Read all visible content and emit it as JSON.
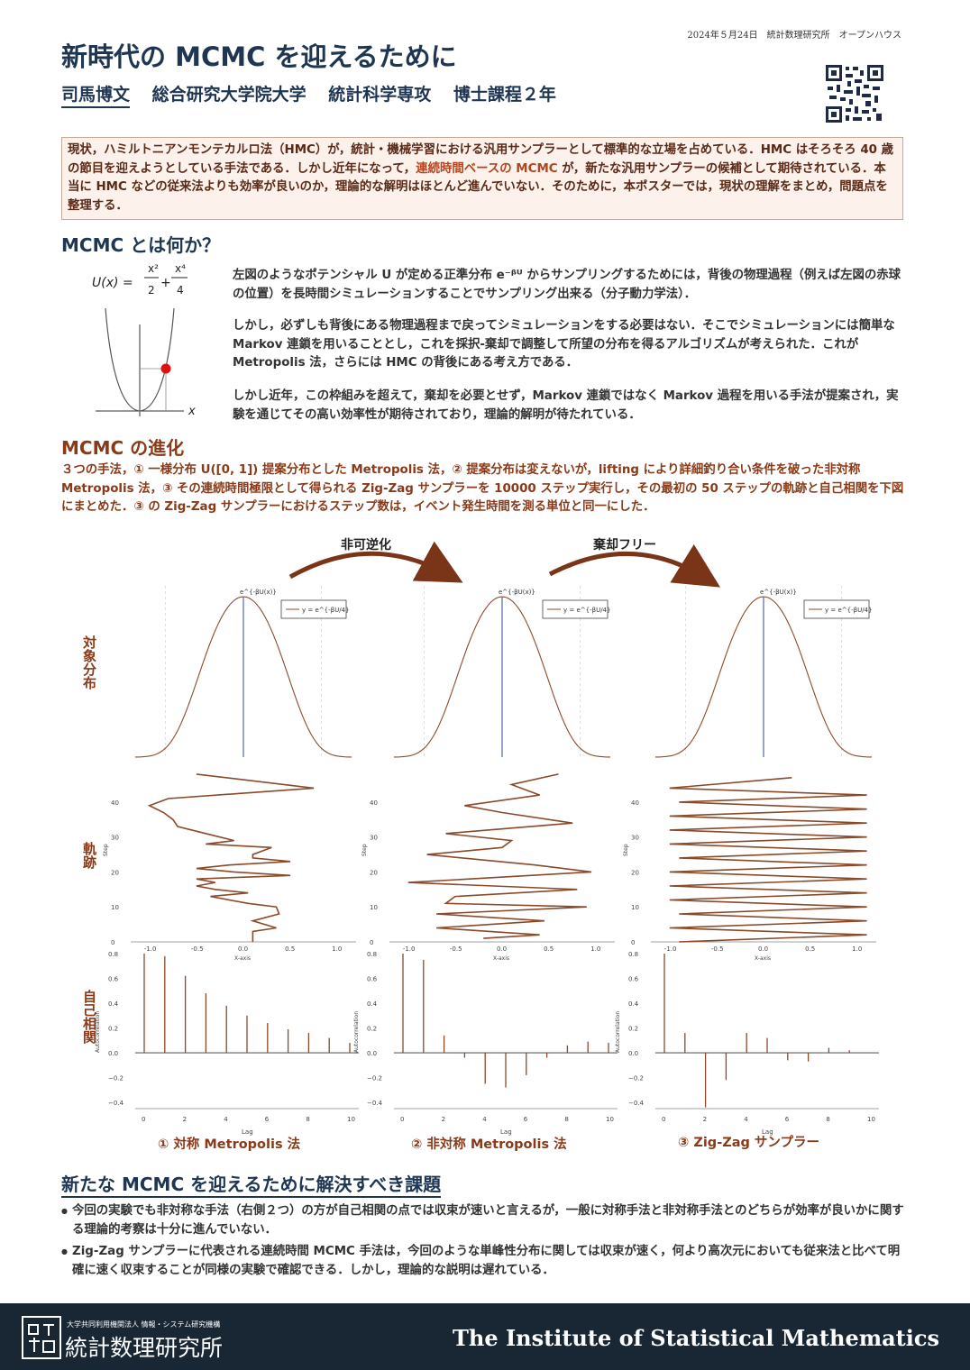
{
  "header": {
    "note": "2024年５月24日　統計数理研究所　オープンハウス",
    "title": "新時代の MCMC を迎えるために",
    "author_name": "司馬博文",
    "author_affil": [
      "総合研究大学院大学",
      "統計科学専攻",
      "博士課程２年"
    ]
  },
  "abstract": {
    "text_a": "現状，ハミルトニアンモンテカルロ法（HMC）が，統計・機械学習における汎用サンプラーとして標準的な立場を占めている．HMC はそろそろ 40 歳の節目を迎えようとしている手法である．しかし近年になって，",
    "highlight": "連続時間ベースの MCMC",
    "text_b": " が，新たな汎用サンプラーの候補として期待されている．本当に HMC などの従来法よりも効率が良いのか，理論的な解明はほとんど進んでいない．そのために，本ポスターでは，現状の理解をまとめ，問題点を整理する．"
  },
  "section1": {
    "heading": "MCMC とは何か？",
    "formula_lhs": "U(x) =",
    "formula_num1": "x²",
    "formula_den1": "2",
    "formula_plus": "+",
    "formula_num2": "x⁴",
    "formula_den2": "4",
    "axis_x": "x",
    "p1": "左図のようなポテンシャル U が定める正準分布 e⁻ᵝᵁ からサンプリングするためには，背後の物理過程（例えば左図の赤球の位置）を長時間シミュレーションすることでサンプリング出来る（分子動力学法）．",
    "p2": "しかし，必ずしも背後にある物理過程まで戻ってシミュレーションをする必要はない．そこでシミュレーションには簡単な Markov 連鎖を用いることとし，これを採択-棄却で調整して所望の分布を得るアルゴリズムが考えられた．これが Metropolis 法，さらには HMC の背後にある考え方である．",
    "p3": "しかし近年，この枠組みを超えて，棄却を必要とせず，Markov 連鎖ではなく Markov 過程を用いる手法が提案され，実験を通じてその高い効率性が期待されており，理論的解明が待たれている．"
  },
  "section2": {
    "heading": "MCMC の進化",
    "p1": "３つの手法，① 一様分布 U([0, 1]) 提案分布とした Metropolis 法，② 提案分布は変えないが，lifting により詳細釣り合い条件を破った非対称 Metropolis 法，③ その連続時間極限として得られる Zig-Zag サンプラーを 10000 ステップ実行し，その最初の 50 ステップの軌跡と自己相関を下図にまとめた．③ の Zig-Zag サンプラーにおけるステップ数は，イベント発生時間を測る単位と同一にした．",
    "arrow1": "非可逆化",
    "arrow2": "棄却フリー",
    "row_target": "対象分布",
    "row_traj": "軌跡",
    "row_acf": "自己相関",
    "captions": [
      "① 対称 Metropolis 法",
      "② 非対称 Metropolis 法",
      "③ Zig-Zag サンプラー"
    ]
  },
  "chart_data": [
    {
      "type": "line",
      "role": "target-density",
      "annotation": "e^{-βU(x)}",
      "legend": "y = e^{-βU/4}",
      "x": [
        -1.6,
        -1.2,
        -0.8,
        -0.4,
        0.0,
        0.4,
        0.8,
        1.2,
        1.6
      ],
      "y": [
        0.03,
        0.21,
        0.56,
        0.88,
        1.0,
        0.88,
        0.56,
        0.21,
        0.03
      ]
    },
    {
      "type": "line",
      "role": "trajectory",
      "panel": 1,
      "xlabel": "X-axis",
      "ylabel": "Step",
      "xlim": [
        -1.2,
        1.2
      ],
      "ylim": [
        0,
        49
      ],
      "xticks": [
        "-1.0",
        "-0.5",
        "0.0",
        "0.5",
        "1.0"
      ],
      "yticks": [
        "0",
        "10",
        "20",
        "30",
        "40"
      ],
      "x": [
        0.1,
        0.1,
        0.35,
        0.1,
        0.38,
        0.35,
        0.05,
        -0.35,
        0.05,
        -0.3,
        -0.5,
        -0.3,
        -0.5,
        0.5,
        -0.1,
        -0.5,
        -0.15,
        0.5,
        0.1,
        0.1,
        0.3,
        -0.4,
        -0.1,
        -0.4,
        -0.7,
        -0.75,
        -0.85,
        -1.0,
        -0.8,
        0.75,
        -0.5
      ],
      "y": [
        0,
        3,
        4,
        6,
        8,
        10,
        11,
        13,
        14,
        15,
        16,
        17,
        18,
        19,
        20,
        21,
        22,
        23,
        24,
        25,
        27,
        28,
        29,
        31,
        33,
        35,
        37,
        39,
        41,
        44,
        48
      ]
    },
    {
      "type": "line",
      "role": "trajectory",
      "panel": 2,
      "xlabel": "X-axis",
      "ylabel": "Step",
      "xlim": [
        -1.2,
        1.2
      ],
      "ylim": [
        0,
        49
      ],
      "xticks": [
        "-1.0",
        "-0.5",
        "0.0",
        "0.5",
        "1.0"
      ],
      "yticks": [
        "0",
        "10",
        "20",
        "30",
        "40"
      ],
      "x": [
        -0.2,
        0.4,
        -0.7,
        0.45,
        -0.7,
        0.9,
        -0.6,
        -0.5,
        0.8,
        -1.0,
        0.95,
        0.35,
        -0.8,
        0.0,
        0.1,
        -0.6,
        0.75,
        0.0,
        -0.4,
        0.4,
        0.1,
        0.6
      ],
      "y": [
        1,
        2,
        4,
        6,
        8,
        10,
        11,
        13,
        15,
        17,
        20,
        22,
        25,
        27,
        29,
        31,
        34,
        37,
        39,
        42,
        45,
        48
      ]
    },
    {
      "type": "line",
      "role": "trajectory",
      "panel": 3,
      "xlabel": "X-axis",
      "ylabel": "Step",
      "xlim": [
        -1.2,
        1.2
      ],
      "ylim": [
        0,
        49
      ],
      "xticks": [
        "-1.0",
        "-0.5",
        "0.0",
        "0.5",
        "1.0"
      ],
      "yticks": [
        "0",
        "10",
        "20",
        "30",
        "40"
      ],
      "x": [
        -0.9,
        1.1,
        -1.0,
        1.1,
        -0.9,
        1.1,
        -1.0,
        1.1,
        -1.0,
        1.1,
        -1.0,
        1.1,
        -0.9,
        1.1,
        -1.0,
        1.1,
        -1.0,
        1.1,
        -1.0,
        1.1,
        -0.9,
        1.1,
        -1.0,
        0.3
      ],
      "y": [
        0,
        2,
        4,
        6,
        8,
        10,
        12,
        14,
        16,
        18,
        20,
        22,
        24,
        26,
        28,
        30,
        32,
        34,
        36,
        38,
        40,
        42,
        44,
        47
      ]
    },
    {
      "type": "bar",
      "role": "autocorrelation",
      "panel": 1,
      "xlabel": "Lag",
      "ylabel": "Autocorrelation",
      "ylim": [
        -0.45,
        0.8
      ],
      "yticks": [
        "−0.4",
        "−0.2",
        "0.0",
        "0.2",
        "0.4",
        "0.6",
        "0.8"
      ],
      "xticks": [
        "0",
        "2",
        "4",
        "6",
        "8",
        "10"
      ],
      "categories": [
        0,
        1,
        2,
        3,
        4,
        5,
        6,
        7,
        8,
        9,
        10
      ],
      "values": [
        1.0,
        0.78,
        0.62,
        0.48,
        0.38,
        0.3,
        0.24,
        0.19,
        0.16,
        0.12,
        0.08
      ]
    },
    {
      "type": "bar",
      "role": "autocorrelation",
      "panel": 2,
      "xlabel": "Lag",
      "ylabel": "Autocorrelation",
      "ylim": [
        -0.45,
        0.8
      ],
      "yticks": [
        "−0.4",
        "−0.2",
        "0.0",
        "0.2",
        "0.4",
        "0.6",
        "0.8"
      ],
      "xticks": [
        "0",
        "2",
        "4",
        "6",
        "8",
        "10"
      ],
      "categories": [
        0,
        1,
        2,
        3,
        4,
        5,
        6,
        7,
        8,
        9,
        10
      ],
      "values": [
        1.0,
        0.75,
        0.14,
        -0.04,
        -0.25,
        -0.28,
        -0.18,
        -0.04,
        0.06,
        0.09,
        0.08
      ]
    },
    {
      "type": "bar",
      "role": "autocorrelation",
      "panel": 3,
      "xlabel": "Lag",
      "ylabel": "Autocorrelation",
      "ylim": [
        -0.45,
        0.8
      ],
      "yticks": [
        "−0.4",
        "−0.2",
        "0.0",
        "0.2",
        "0.4",
        "0.6",
        "0.8"
      ],
      "xticks": [
        "0",
        "2",
        "4",
        "6",
        "8",
        "10"
      ],
      "categories": [
        0,
        1,
        2,
        3,
        4,
        5,
        6,
        7,
        8,
        9,
        10
      ],
      "values": [
        1.0,
        0.16,
        -0.44,
        -0.22,
        0.16,
        0.12,
        -0.06,
        -0.07,
        0.04,
        0.02,
        0.0
      ]
    }
  ],
  "section3": {
    "heading": "新たな MCMC を迎えるために解決すべき課題",
    "bullets": [
      "今回の実験でも非対称な手法（右側２つ）の方が自己相関の点では収束が速いと言えるが，一般に対称手法と非対称手法とのどちらが効率が良いかに関する理論的考察は十分に進んでいない．",
      "Zig-Zag サンプラーに代表される連続時間 MCMC 手法は，今回のような単峰性分布に関しては収束が速く，何より高次元においても従来法と比べて明確に速く収束することが同様の実験で確認できる．しかし，理論的な説明は遅れている．"
    ]
  },
  "footer": {
    "jp_small": "大学共同利用機関法人 情報・システム研究機構",
    "jp_big": "統計数理研究所",
    "en": "The Institute of Statistical Mathematics"
  },
  "colors": {
    "accent": "#1f3653",
    "brown": "#8a3a18",
    "line": "#8a4a2a",
    "mark": "#5566aa"
  }
}
